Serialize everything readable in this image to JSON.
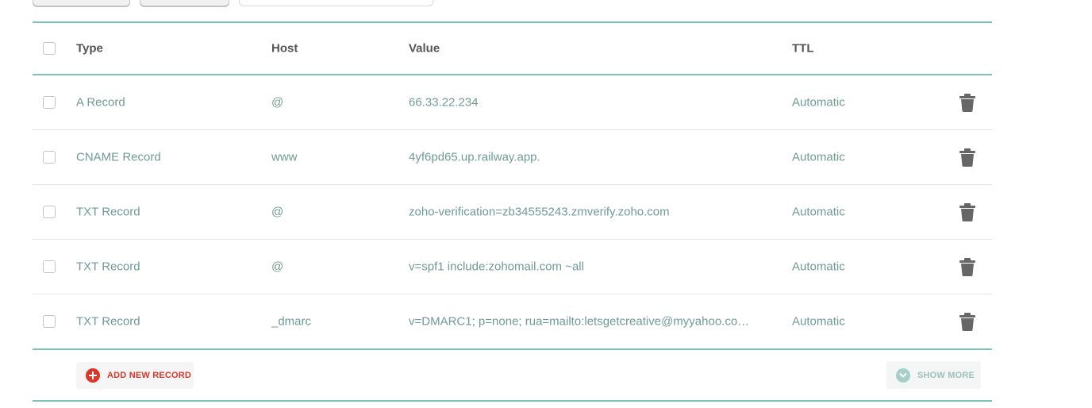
{
  "table": {
    "headers": {
      "type": "Type",
      "host": "Host",
      "value": "Value",
      "ttl": "TTL"
    },
    "rows": [
      {
        "type": "A Record",
        "host": "@",
        "value": "66.33.22.234",
        "ttl": "Automatic"
      },
      {
        "type": "CNAME Record",
        "host": "www",
        "value": "4yf6pd65.up.railway.app.",
        "ttl": "Automatic"
      },
      {
        "type": "TXT Record",
        "host": "@",
        "value": "zoho-verification=zb34555243.zmverify.zoho.com",
        "ttl": "Automatic"
      },
      {
        "type": "TXT Record",
        "host": "@",
        "value": "v=spf1 include:zohomail.com ~all",
        "ttl": "Automatic"
      },
      {
        "type": "TXT Record",
        "host": "_dmarc",
        "value": "v=DMARC1; p=none; rua=mailto:letsgetcreative@myyahoo.co…",
        "ttl": "Automatic"
      }
    ]
  },
  "footer": {
    "add_label": "ADD NEW RECORD",
    "more_label": "SHOW MORE"
  },
  "icons": {
    "delete": "trash-icon",
    "add": "plus-circle-icon",
    "more": "chevron-down-icon"
  },
  "colors": {
    "accent_teal": "#7cc2b6",
    "cell_text": "#6f9b93",
    "danger_red": "#d8372a"
  }
}
